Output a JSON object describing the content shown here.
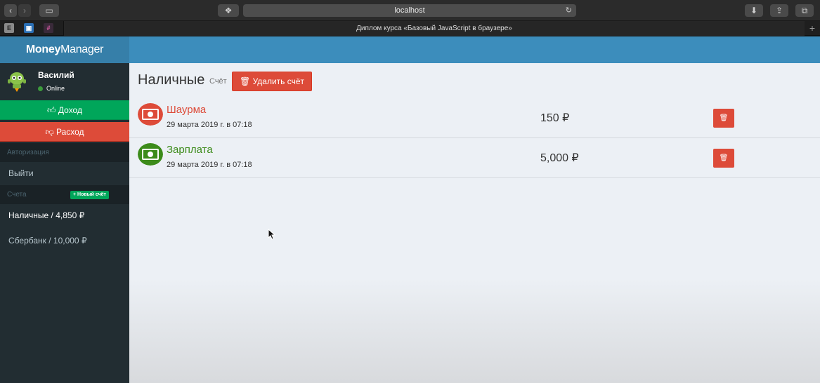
{
  "browser": {
    "url": "localhost",
    "tab_title": "Диплом курса «Базовый JavaScript в браузере»"
  },
  "app": {
    "logo_bold": "Money",
    "logo_rest": "Manager"
  },
  "user": {
    "name": "Василий",
    "status": "Online"
  },
  "actions": {
    "income": "Доход",
    "expense": "Расход"
  },
  "sidebar": {
    "auth_header": "Авторизация",
    "logout": "Выйти",
    "accounts_header": "Счета",
    "new_account": "+ Новый счёт",
    "accounts": [
      {
        "label": "Наличные / 4,850 ₽"
      },
      {
        "label": "Сбербанк / 10,000 ₽"
      }
    ]
  },
  "account": {
    "title": "Наличные",
    "subtitle": "Счёт",
    "delete_label": "Удалить счёт"
  },
  "transactions": [
    {
      "name": "Шаурма",
      "date": "29 марта 2019 г. в 07:18",
      "amount": "150 ₽",
      "color": "#dd4b39"
    },
    {
      "name": "Зарплата",
      "date": "29 марта 2019 г. в 07:18",
      "amount": "5,000 ₽",
      "color": "#3c8b1a"
    }
  ],
  "colors": {
    "accent": "#3c8dbc",
    "sidebar": "#222d32",
    "success": "#00a65a",
    "danger": "#dd4b39"
  }
}
